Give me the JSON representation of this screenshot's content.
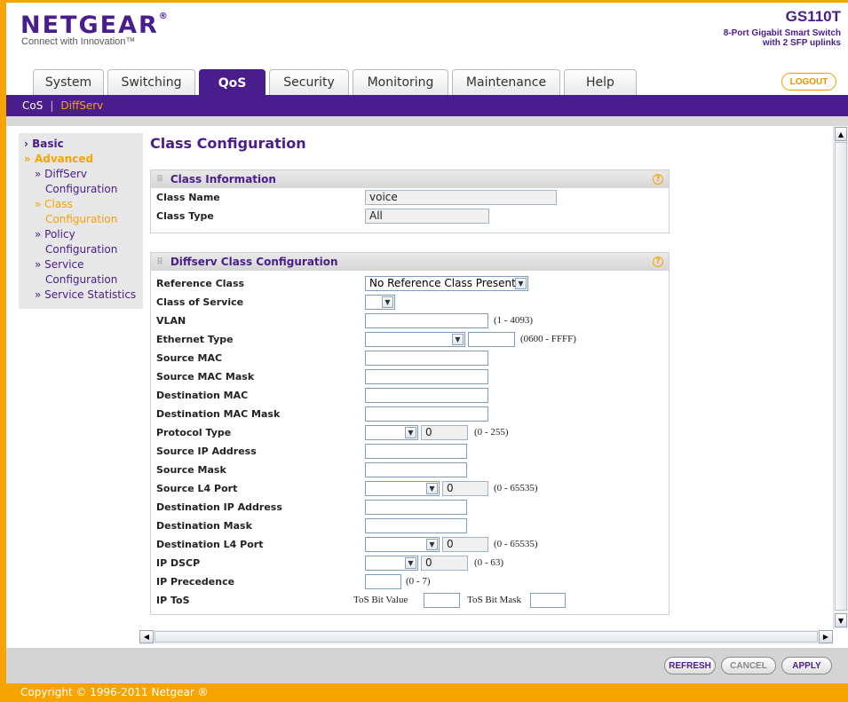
{
  "brand": {
    "logo": "NETGEAR",
    "reg": "®",
    "tagline": "Connect with Innovation™"
  },
  "device": {
    "model": "GS110T",
    "description_line1": "8-Port Gigabit Smart Switch",
    "description_line2": "with 2 SFP uplinks"
  },
  "tabs": [
    {
      "label": "System"
    },
    {
      "label": "Switching"
    },
    {
      "label": "QoS",
      "active": true
    },
    {
      "label": "Security"
    },
    {
      "label": "Monitoring"
    },
    {
      "label": "Maintenance"
    },
    {
      "label": "Help"
    }
  ],
  "logout_label": "LOGOUT",
  "subnav": {
    "items": [
      {
        "label": "CoS"
      },
      {
        "label": "DiffServ",
        "active": true
      }
    ],
    "separator": "|"
  },
  "sidebar": {
    "basic": "Basic",
    "advanced": "Advanced",
    "items": [
      {
        "line1": "» DiffServ",
        "line2": "Configuration"
      },
      {
        "line1": "» Class",
        "line2": "Configuration",
        "active": true
      },
      {
        "line1": "» Policy",
        "line2": "Configuration"
      },
      {
        "line1": "» Service",
        "line2": "Configuration"
      },
      {
        "line1": "» Service Statistics",
        "line2": ""
      }
    ]
  },
  "page_title": "Class Configuration",
  "class_info": {
    "title": "Class Information",
    "help": "?",
    "class_name_label": "Class Name",
    "class_name_value": "voice",
    "class_type_label": "Class Type",
    "class_type_value": "All"
  },
  "diffserv": {
    "title": "Diffserv Class Configuration",
    "help": "?",
    "reference_class_label": "Reference Class",
    "reference_class_value": "No Reference Class Present",
    "cos_label": "Class of Service",
    "vlan_label": "VLAN",
    "vlan_range": "(1 - 4093)",
    "ethertype_label": "Ethernet Type",
    "ethertype_range": "(0600 - FFFF)",
    "src_mac_label": "Source MAC",
    "src_mac_mask_label": "Source MAC Mask",
    "dst_mac_label": "Destination MAC",
    "dst_mac_mask_label": "Destination MAC Mask",
    "protocol_label": "Protocol Type",
    "protocol_value": "0",
    "protocol_range": "(0 - 255)",
    "src_ip_label": "Source IP Address",
    "src_mask_label": "Source Mask",
    "src_l4_label": "Source L4 Port",
    "src_l4_value": "0",
    "src_l4_range": "(0 - 65535)",
    "dst_ip_label": "Destination IP Address",
    "dst_mask_label": "Destination Mask",
    "dst_l4_label": "Destination L4 Port",
    "dst_l4_value": "0",
    "dst_l4_range": "(0 - 65535)",
    "dscp_label": "IP DSCP",
    "dscp_value": "0",
    "dscp_range": "(0 - 63)",
    "precedence_label": "IP Precedence",
    "precedence_range": "(0 - 7)",
    "tos_label": "IP ToS",
    "tos_bit_value_label": "ToS Bit Value",
    "tos_bit_mask_label": "ToS Bit Mask"
  },
  "buttons": {
    "refresh": "REFRESH",
    "cancel": "CANCEL",
    "apply": "APPLY"
  },
  "footer": "Copyright © 1996-2011 Netgear ®",
  "colors": {
    "brand_purple": "#4a1d8c",
    "accent_orange": "#f7a400"
  }
}
